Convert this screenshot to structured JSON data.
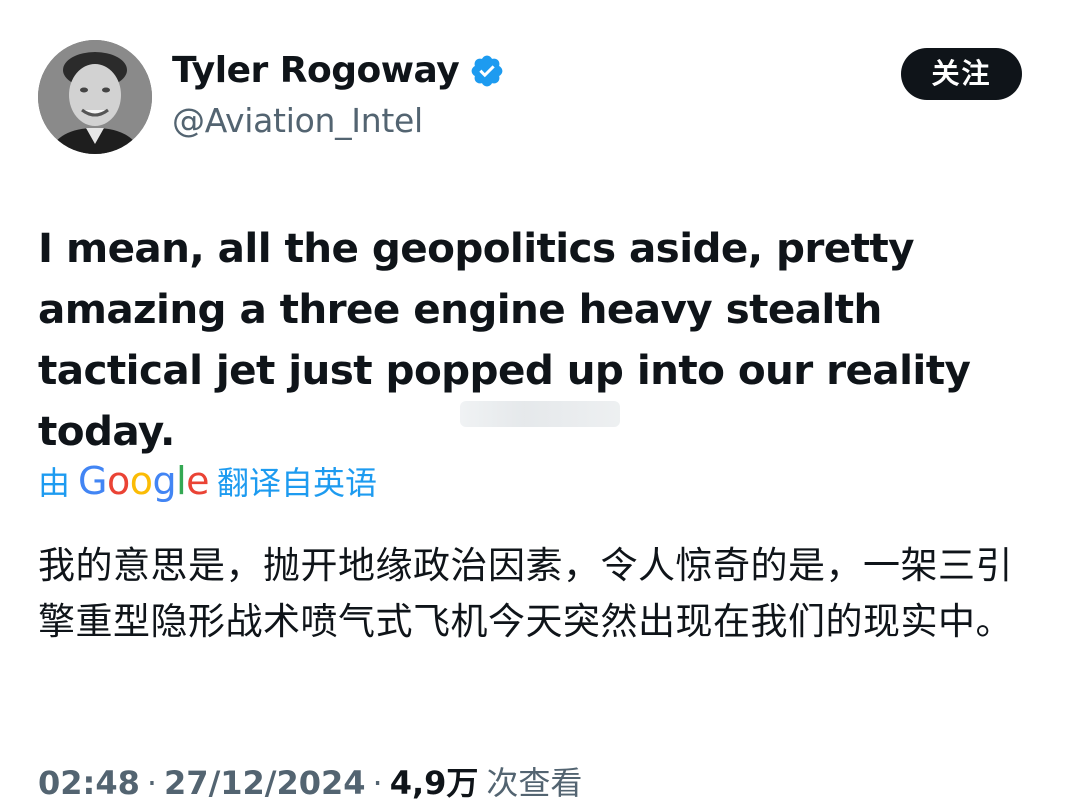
{
  "author": {
    "display_name": "Tyler Rogoway",
    "handle": "@Aviation_Intel",
    "avatar_icon": "user-avatar-photo",
    "verified_icon": "verified-badge-icon",
    "verified_color": "#1d9bf0"
  },
  "follow_button": {
    "label": "关注"
  },
  "tweet": {
    "text": "I mean, all the geopolitics aside, pretty amazing a three engine heavy stealth tactical jet just popped up into our reality today."
  },
  "translation": {
    "by_label": "由",
    "provider": [
      "G",
      "o",
      "o",
      "g",
      "l",
      "e"
    ],
    "provider_colors": [
      "#4285f4",
      "#ea4335",
      "#fbbc05",
      "#4285f4",
      "#34a853",
      "#ea4335"
    ],
    "from_label": "翻译自英语",
    "link_color": "#1d9bf0",
    "text": "我的意思是，抛开地缘政治因素，令人惊奇的是，一架三引擎重型隐形战术喷气式飞机今天突然出现在我们的现实中。"
  },
  "meta": {
    "time": "02:48",
    "separator": "·",
    "date": "27/12/2024",
    "views_count": "4,9万",
    "views_label": "次查看"
  }
}
